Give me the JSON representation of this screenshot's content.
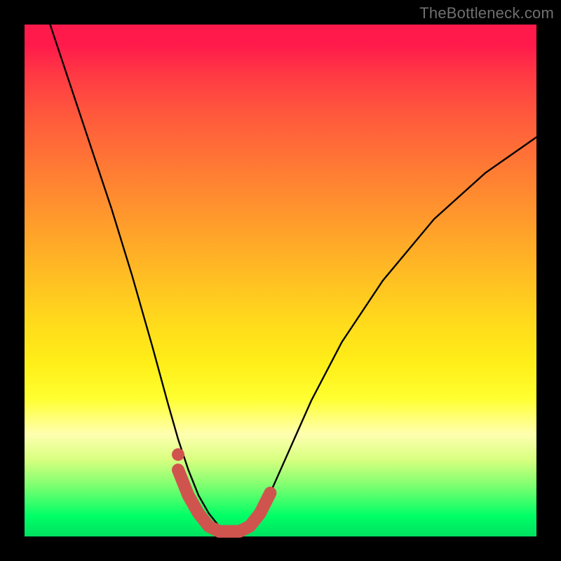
{
  "watermark": "TheBottleneck.com",
  "chart_data": {
    "type": "line",
    "title": "",
    "xlabel": "",
    "ylabel": "",
    "xlim": [
      0,
      1
    ],
    "ylim": [
      0,
      1
    ],
    "series": [
      {
        "name": "bottleneck-curve",
        "x": [
          0.05,
          0.09,
          0.13,
          0.17,
          0.21,
          0.25,
          0.28,
          0.3,
          0.32,
          0.34,
          0.36,
          0.38,
          0.4,
          0.42,
          0.44,
          0.46,
          0.48,
          0.52,
          0.56,
          0.62,
          0.7,
          0.8,
          0.9,
          1.0
        ],
        "values": [
          1.0,
          0.88,
          0.76,
          0.64,
          0.51,
          0.37,
          0.26,
          0.19,
          0.13,
          0.08,
          0.045,
          0.02,
          0.01,
          0.01,
          0.02,
          0.045,
          0.085,
          0.175,
          0.265,
          0.38,
          0.5,
          0.62,
          0.71,
          0.78
        ]
      }
    ],
    "highlight": {
      "name": "optimal-zone",
      "color": "#d0544e",
      "x": [
        0.3,
        0.32,
        0.34,
        0.36,
        0.38,
        0.4,
        0.42,
        0.44,
        0.46,
        0.48
      ],
      "values": [
        0.13,
        0.08,
        0.045,
        0.02,
        0.01,
        0.01,
        0.01,
        0.02,
        0.045,
        0.085
      ]
    }
  },
  "colors": {
    "curve": "#000000",
    "highlight": "#d0544e",
    "background_top": "#ff1a4b",
    "background_bottom": "#00e060",
    "frame": "#000000",
    "watermark": "#6f6f6f"
  }
}
